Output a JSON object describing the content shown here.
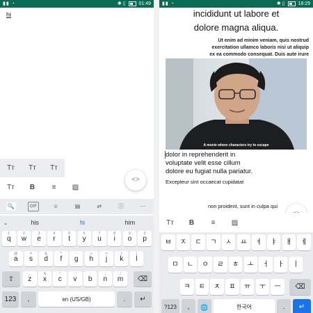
{
  "status_left": {
    "time": "01:49"
  },
  "status_right": {
    "time": "18:29"
  },
  "left": {
    "editor_text": "hi",
    "format_row1": [
      {
        "label": "Tт",
        "icon": "text-size-small-icon"
      },
      {
        "label": "Tт",
        "icon": "text-size-medium-icon"
      },
      {
        "label": "Tт",
        "icon": "text-size-large-icon"
      }
    ],
    "format_row2": [
      {
        "label": "Tт",
        "icon": "text-size-icon"
      },
      {
        "label": "B",
        "icon": "bold-icon"
      },
      {
        "label": "≡",
        "icon": "align-icon"
      },
      {
        "label": "▨",
        "icon": "image-icon"
      }
    ],
    "fab_label": "<>",
    "toolbar": [
      {
        "label": "🔍",
        "icon": "search-icon"
      },
      {
        "label": "GIF",
        "icon": "gif-icon"
      },
      {
        "label": "☺",
        "icon": "sticker-icon"
      },
      {
        "label": "▤",
        "icon": "clipboard-icon"
      },
      {
        "label": "⇄",
        "icon": "translate-icon"
      },
      {
        "label": "ⓘ",
        "icon": "info-icon"
      },
      {
        "label": "···",
        "icon": "more-icon"
      }
    ],
    "suggestions": {
      "collapse": "⌄",
      "items": [
        "his",
        "hi",
        "him"
      ]
    },
    "rows": [
      [
        {
          "m": "q",
          "s": "1"
        },
        {
          "m": "w",
          "s": "2"
        },
        {
          "m": "e",
          "s": "3"
        },
        {
          "m": "r",
          "s": "4"
        },
        {
          "m": "t",
          "s": "5"
        },
        {
          "m": "y",
          "s": "6"
        },
        {
          "m": "u",
          "s": "7"
        },
        {
          "m": "i",
          "s": "8"
        },
        {
          "m": "o",
          "s": "9"
        },
        {
          "m": "p",
          "s": "0"
        }
      ],
      [
        {
          "m": "a",
          "s": "@"
        },
        {
          "m": "s",
          "s": "#"
        },
        {
          "m": "d",
          "s": "&"
        },
        {
          "m": "f",
          "s": "*"
        },
        {
          "m": "g",
          "s": "-"
        },
        {
          "m": "h",
          "s": "+"
        },
        {
          "m": "j",
          "s": "="
        },
        {
          "m": "k",
          "s": "("
        },
        {
          "m": "l",
          "s": ")"
        }
      ],
      [
        {
          "m": "z",
          "s": "_"
        },
        {
          "m": "x",
          "s": "$"
        },
        {
          "m": "c",
          "s": "\""
        },
        {
          "m": "v",
          "s": "'"
        },
        {
          "m": "b",
          "s": ":"
        },
        {
          "m": "n",
          "s": ";"
        },
        {
          "m": "m",
          "s": "/"
        }
      ]
    ],
    "shift": "⇧",
    "backspace": "⌫",
    "num_key": "123",
    "comma": ",",
    "space": "en (US/GB)",
    "period": ".",
    "enter": "↵"
  },
  "right": {
    "heading_lines": [
      "incididunt ut labore et",
      "dolore magna aliqua."
    ],
    "small_lines": [
      "Ut enim ad minim veniam, quis nostrud",
      "exercitation ullamco laboris nisi ut aliquip",
      "ex ea commodo consequat. Duis aute irure"
    ],
    "caption": "A movie where characters try to escape",
    "para_lines": [
      "dolor in reprehenderit in",
      "voluptate velit esse cillum",
      "dolore eu fugiat nulla pariatur."
    ],
    "para2": "Excepteur sint occaecat cupidatat",
    "para3": "non proident, sunt in culpa qui",
    "fab_label": "<>",
    "format_row": [
      {
        "label": "Tт",
        "icon": "text-size-icon"
      },
      {
        "label": "B",
        "icon": "bold-icon"
      },
      {
        "label": "≡",
        "icon": "align-icon"
      },
      {
        "label": "▨",
        "icon": "image-icon"
      }
    ],
    "rows": [
      [
        "ㅂ",
        "ㅈ",
        "ㄷ",
        "ㄱ",
        "ㅅ",
        "ㅛ",
        "ㅕ",
        "ㅑ",
        "ㅐ",
        "ㅔ"
      ],
      [
        "ㅁ",
        "ㄴ",
        "ㅇ",
        "ㄹ",
        "ㅎ",
        "ㅗ",
        "ㅓ",
        "ㅏ",
        "ㅣ"
      ],
      [
        "ㅋ",
        "ㅌ",
        "ㅊ",
        "ㅍ",
        "ㅠ",
        "ㅜ",
        "ㅡ"
      ]
    ],
    "backspace": "⌫",
    "sym_key": "?123",
    "comma": ",",
    "globe": "🌐",
    "space": "한국어",
    "period": ".",
    "enter": "↵"
  }
}
